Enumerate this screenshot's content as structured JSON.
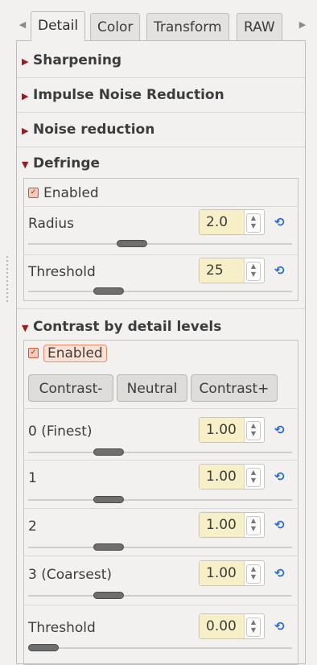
{
  "tabs": [
    {
      "label": "Detail",
      "active": true
    },
    {
      "label": "Color",
      "active": false
    },
    {
      "label": "Transform",
      "active": false
    },
    {
      "label": "RAW",
      "active": false
    }
  ],
  "sections": {
    "sharpening": "Sharpening",
    "impulse": "Impulse Noise Reduction",
    "noise": "Noise reduction",
    "defringe": "Defringe",
    "contrast": "Contrast by detail levels"
  },
  "defringe": {
    "enabled_label": "Enabled",
    "enabled": true,
    "radius_label": "Radius",
    "radius_value": "2.0",
    "radius_level": 0.38,
    "threshold_label": "Threshold",
    "threshold_value": "25",
    "threshold_level": 0.28
  },
  "contrast": {
    "enabled_label": "Enabled",
    "enabled": true,
    "buttons": [
      "Contrast-",
      "Neutral",
      "Contrast+"
    ],
    "levels": [
      {
        "label": "0 (Finest)",
        "value": "1.00",
        "level": 0.28
      },
      {
        "label": "1",
        "value": "1.00",
        "level": 0.28
      },
      {
        "label": "2",
        "value": "1.00",
        "level": 0.28
      },
      {
        "label": "3 (Coarsest)",
        "value": "1.00",
        "level": 0.28
      }
    ],
    "threshold_label": "Threshold",
    "threshold_value": "0.00",
    "threshold_level": 0.0
  },
  "colors": {
    "triangle": "#a01818",
    "value_bg": "#f7efc8",
    "reset_icon": "#2b6ccf"
  },
  "icons": {
    "reset": "reset-icon",
    "tab_left": "chevron-left-icon",
    "tab_right": "chevron-right-icon"
  }
}
